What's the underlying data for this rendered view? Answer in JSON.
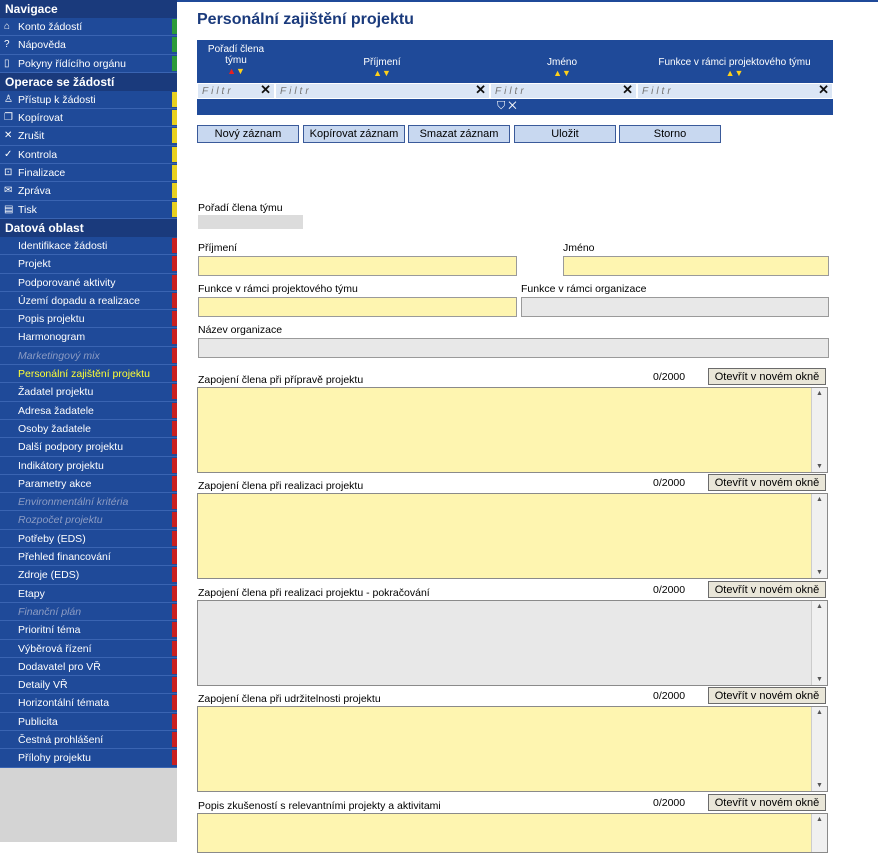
{
  "sidebar": {
    "nav_header": "Navigace",
    "nav_items": [
      {
        "icon": "⌂",
        "icon_name": "home-icon",
        "label": "Konto žádostí",
        "stripe": "#2b9a3a"
      },
      {
        "icon": "?",
        "icon_name": "help-icon",
        "label": "Nápověda",
        "stripe": "#2b9a3a"
      },
      {
        "icon": "▯",
        "icon_name": "book-icon",
        "label": "Pokyny řídícího orgánu",
        "stripe": "#2b9a3a"
      }
    ],
    "ops_header": "Operace se žádostí",
    "ops_items": [
      {
        "icon": "♙",
        "icon_name": "user-icon",
        "label": "Přístup k žádosti",
        "stripe": "#e8d020"
      },
      {
        "icon": "❐",
        "icon_name": "copy-icon",
        "label": "Kopírovat",
        "stripe": "#e8d020"
      },
      {
        "icon": "✕",
        "icon_name": "cancel-icon",
        "label": "Zrušit",
        "stripe": "#e8d020"
      },
      {
        "icon": "✓",
        "icon_name": "check-icon",
        "label": "Kontrola",
        "stripe": "#e8d020"
      },
      {
        "icon": "⊡",
        "icon_name": "lock-icon",
        "label": "Finalizace",
        "stripe": "#e8d020"
      },
      {
        "icon": "✉",
        "icon_name": "mail-icon",
        "label": "Zpráva",
        "stripe": "#e8d020"
      },
      {
        "icon": "▤",
        "icon_name": "print-icon",
        "label": "Tisk",
        "stripe": "#e8d020"
      }
    ],
    "data_header": "Datová oblast",
    "data_items": [
      {
        "label": "Identifikace žádosti",
        "state": "normal"
      },
      {
        "label": "Projekt",
        "state": "normal"
      },
      {
        "label": "Podporované aktivity",
        "state": "normal"
      },
      {
        "label": "Území dopadu a realizace",
        "state": "normal"
      },
      {
        "label": "Popis projektu",
        "state": "normal"
      },
      {
        "label": "Harmonogram",
        "state": "normal"
      },
      {
        "label": "Marketingový mix",
        "state": "disabled"
      },
      {
        "label": "Personální zajištění projektu",
        "state": "active"
      },
      {
        "label": "Žadatel projektu",
        "state": "normal"
      },
      {
        "label": "Adresa žadatele",
        "state": "normal"
      },
      {
        "label": "Osoby žadatele",
        "state": "normal"
      },
      {
        "label": "Další podpory projektu",
        "state": "normal"
      },
      {
        "label": "Indikátory projektu",
        "state": "normal"
      },
      {
        "label": "Parametry akce",
        "state": "normal"
      },
      {
        "label": "Environmentální kritéria",
        "state": "disabled"
      },
      {
        "label": "Rozpočet projektu",
        "state": "disabled"
      },
      {
        "label": "Potřeby (EDS)",
        "state": "normal"
      },
      {
        "label": "Přehled financování",
        "state": "normal"
      },
      {
        "label": "Zdroje (EDS)",
        "state": "normal"
      },
      {
        "label": "Etapy",
        "state": "normal"
      },
      {
        "label": "Finanční plán",
        "state": "disabled"
      },
      {
        "label": "Prioritní téma",
        "state": "normal"
      },
      {
        "label": "Výběrová řízení",
        "state": "normal"
      },
      {
        "label": "Dodavatel pro VŘ",
        "state": "normal"
      },
      {
        "label": "Detaily VŘ",
        "state": "normal"
      },
      {
        "label": "Horizontální témata",
        "state": "normal"
      },
      {
        "label": "Publicita",
        "state": "normal"
      },
      {
        "label": "Čestná prohlášení",
        "state": "normal"
      },
      {
        "label": "Přílohy projektu",
        "state": "normal"
      }
    ],
    "data_stripe": "#c82020"
  },
  "page_title": "Personální zajištění projektu",
  "grid": {
    "columns": [
      {
        "label_line1": "Pořadí člena",
        "label_line2": "týmu"
      },
      {
        "label_line1": "Příjmení",
        "label_line2": ""
      },
      {
        "label_line1": "Jméno",
        "label_line2": ""
      },
      {
        "label_line1": "Funkce v rámci projektového týmu",
        "label_line2": ""
      }
    ],
    "filter_placeholder": "Filtr",
    "filter_clear": "✕",
    "filter_icon": "funnel-icon",
    "controls": "⛉ ✕"
  },
  "toolbar": {
    "new": "Nový záznam",
    "copy": "Kopírovat záznam",
    "delete": "Smazat záznam",
    "save": "Uložit",
    "cancel": "Storno"
  },
  "form": {
    "poradi_label": "Pořadí člena týmu",
    "prijmeni_label": "Příjmení",
    "jmeno_label": "Jméno",
    "funkce_tym_label": "Funkce v rámci projektového týmu",
    "funkce_org_label": "Funkce v rámci organizace",
    "nazev_org_label": "Název organizace",
    "open_label": "Otevřít v novém okně",
    "textareas": [
      {
        "label": "Zapojení člena při přípravě projektu",
        "count": "0/2000",
        "state": "editable"
      },
      {
        "label": "Zapojení člena při realizaci projektu",
        "count": "0/2000",
        "state": "editable"
      },
      {
        "label": "Zapojení člena při realizaci projektu - pokračování",
        "count": "0/2000",
        "state": "readonly"
      },
      {
        "label": "Zapojení člena při udržitelnosti projektu",
        "count": "0/2000",
        "state": "editable"
      },
      {
        "label": "Popis zkušeností s relevantními projekty a aktivitami",
        "count": "0/2000",
        "state": "editable"
      }
    ]
  },
  "colors": {
    "sidebar_bg": "#1f4a99",
    "header_bg": "#1a3a7c",
    "active_text": "#ffff33",
    "field_editable": "#fef5b0",
    "field_readonly": "#e8e8e8"
  }
}
